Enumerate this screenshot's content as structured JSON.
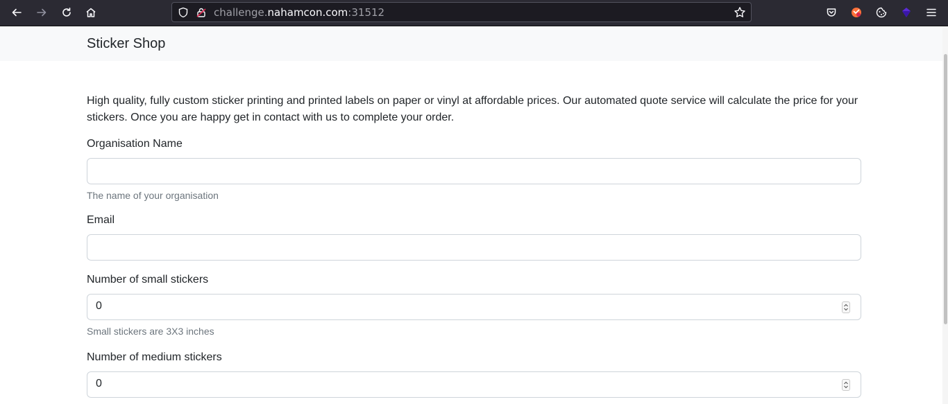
{
  "browser": {
    "url_prefix": "challenge.",
    "url_host": "nahamcon.com",
    "url_port": ":31512"
  },
  "navbar": {
    "brand": "Sticker Shop"
  },
  "main": {
    "intro": "High quality, fully custom sticker printing and printed labels on paper or vinyl at affordable prices. Our automated quote service will calculate the price for your stickers. Once you are happy get in contact with us to complete your order.",
    "fields": [
      {
        "label": "Organisation Name",
        "value": "",
        "help": "The name of your organisation"
      },
      {
        "label": "Email",
        "value": ""
      },
      {
        "label": "Number of small stickers",
        "value": "0",
        "help": "Small stickers are 3X3 inches"
      },
      {
        "label": "Number of medium stickers",
        "value": "0"
      }
    ]
  }
}
